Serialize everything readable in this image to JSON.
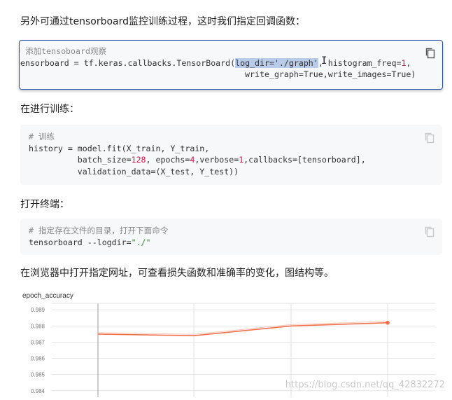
{
  "paragraphs": {
    "p1": "另外可通过tensorboard监控训练过程，这时我们指定回调函数：",
    "p2": "在进行训练：",
    "p3": "打开终端：",
    "p4": "在浏览器中打开指定网址，可查看损失函数和准确率的变化，图结构等。"
  },
  "code1": {
    "comment": "# 添加tensoboard观察",
    "line1_a": "tensorboard = tf.keras.callbacks.TensorBoard(",
    "line1_sel": "log_dir='./graph'",
    "line1_b": ", histogram_freq=",
    "line1_num": "1",
    "line1_c": ",",
    "line2_a": "                                               write_graph=True,write_images=True)"
  },
  "code2": {
    "comment": "# 训练",
    "line1": "history = model.fit(X_train, Y_train,",
    "line2_a": "          batch_size=",
    "line2_n1": "128",
    "line2_b": ", epochs=",
    "line2_n2": "4",
    "line2_c": ",verbose=",
    "line2_n3": "1",
    "line2_d": ",callbacks=[tensorboard],",
    "line3": "          validation_data=(X_test, Y_test))"
  },
  "code3": {
    "comment": "# 指定存在文件的目录，打开下面命令",
    "line1_a": "tensorboard --logdir=",
    "line1_str": "\"./\""
  },
  "chart_data": {
    "type": "line",
    "title": "epoch_accuracy",
    "xlabel": "",
    "ylabel": "",
    "x": [
      0,
      1,
      2,
      3
    ],
    "series": [
      {
        "values": [
          0.9875,
          0.9874,
          0.988,
          0.9882
        ],
        "color": "#f0714b"
      }
    ],
    "yticks": [
      "0.989",
      "0.988",
      "0.987",
      "0.986",
      "0.985",
      "0.984"
    ],
    "ylim": [
      0.9836,
      0.9894
    ],
    "grid": true
  },
  "watermark": "https://blog.csdn.net/qq_42832272",
  "icons": {
    "copy": "copy-icon"
  }
}
